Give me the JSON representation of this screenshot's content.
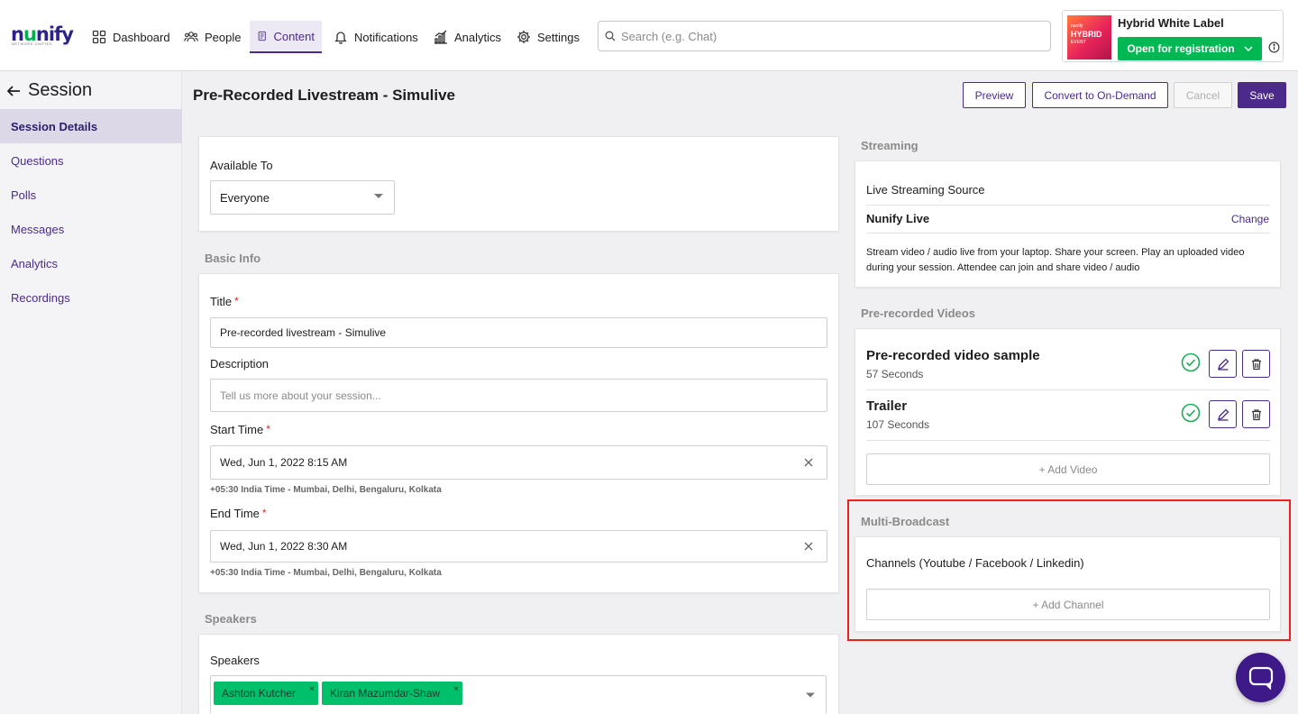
{
  "brand": {
    "logo_text_pre": "n",
    "logo_text_u": "u",
    "logo_text_post": "nify",
    "logo_tag": "NETWORK UNIFIED"
  },
  "nav": {
    "dashboard": "Dashboard",
    "people": "People",
    "content": "Content",
    "notifications": "Notifications",
    "analytics": "Analytics",
    "settings": "Settings"
  },
  "search": {
    "placeholder": "Search (e.g. Chat)"
  },
  "event": {
    "thumb_small": "nunify",
    "thumb_line1": "HYBRID",
    "thumb_line2": "EVENT",
    "name": "Hybrid White Label",
    "status_button": "Open for registration"
  },
  "sidebar": {
    "title": "Session",
    "items": [
      {
        "label": "Session Details"
      },
      {
        "label": "Questions"
      },
      {
        "label": "Polls"
      },
      {
        "label": "Messages"
      },
      {
        "label": "Analytics"
      },
      {
        "label": "Recordings"
      }
    ]
  },
  "header": {
    "title": "Pre-Recorded Livestream - Simulive",
    "preview": "Preview",
    "convert": "Convert to On-Demand",
    "cancel": "Cancel",
    "save": "Save"
  },
  "availability": {
    "label": "Available To",
    "value": "Everyone"
  },
  "basic_info": {
    "section": "Basic Info",
    "title_label": "Title",
    "title_value": "Pre-recorded livestream - Simulive",
    "required_mark": "*",
    "description_label": "Description",
    "description_placeholder": "Tell us more about your session...",
    "start_label": "Start Time",
    "start_value": "Wed, Jun 1, 2022 8:15 AM",
    "start_tz": "+05:30 India Time - Mumbai, Delhi, Bengaluru, Kolkata",
    "end_label": "End Time",
    "end_value": "Wed, Jun 1, 2022 8:30 AM",
    "end_tz": "+05:30 India Time - Mumbai, Delhi, Bengaluru, Kolkata"
  },
  "speakers": {
    "section": "Speakers",
    "label": "Speakers",
    "chips": [
      "Ashton Kutcher",
      "Kiran Mazumdar-Shaw"
    ],
    "chip_remove": "×"
  },
  "streaming": {
    "section": "Streaming",
    "source_label": "Live Streaming Source",
    "source_value": "Nunify Live",
    "change": "Change",
    "description": "Stream video / audio live from your laptop. Share your screen. Play an uploaded video during your session. Attendee can join and share video / audio"
  },
  "prerecorded": {
    "section": "Pre-recorded Videos",
    "videos": [
      {
        "title": "Pre-recorded video sample",
        "duration": "57 Seconds"
      },
      {
        "title": "Trailer",
        "duration": "107 Seconds"
      }
    ],
    "add": "+ Add Video"
  },
  "multibroadcast": {
    "section": "Multi-Broadcast",
    "channels_label": "Channels (Youtube / Facebook / Linkedin)",
    "add": "+ Add Channel"
  },
  "colors": {
    "brand_purple": "#4b2a8c",
    "success_green": "#00b853",
    "highlight_red": "#e8231f"
  }
}
